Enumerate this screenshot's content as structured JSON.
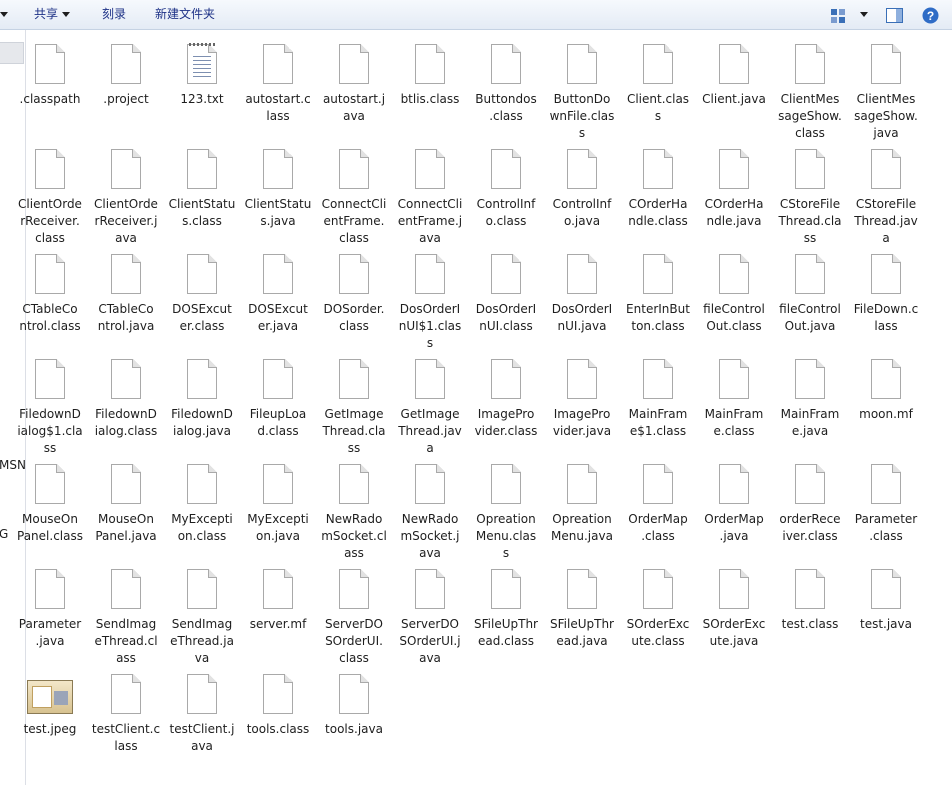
{
  "toolbar": {
    "share": "共享",
    "burn": "刻录",
    "new_folder": "新建文件夹"
  },
  "nav": {
    "msn": "MSN",
    "g": "G"
  },
  "files": [
    {
      "line1": ".classpath",
      "line2": "",
      "line3": "",
      "icon": "document-icon"
    },
    {
      "line1": ".project",
      "line2": "",
      "line3": "",
      "icon": "document-icon"
    },
    {
      "line1": "123.txt",
      "line2": "",
      "line3": "",
      "icon": "text-file-icon"
    },
    {
      "line1": "autostart.c",
      "line2": "lass",
      "line3": "",
      "icon": "document-icon"
    },
    {
      "line1": "autostart.j",
      "line2": "ava",
      "line3": "",
      "icon": "document-icon"
    },
    {
      "line1": "btlis.class",
      "line2": "",
      "line3": "",
      "icon": "document-icon"
    },
    {
      "line1": "Buttondos",
      "line2": ".class",
      "line3": "",
      "icon": "document-icon"
    },
    {
      "line1": "ButtonDo",
      "line2": "wnFile.clas",
      "line3": "s",
      "icon": "document-icon"
    },
    {
      "line1": "Client.clas",
      "line2": "s",
      "line3": "",
      "icon": "document-icon"
    },
    {
      "line1": "Client.java",
      "line2": "",
      "line3": "",
      "icon": "document-icon"
    },
    {
      "line1": "ClientMes",
      "line2": "sageShow.",
      "line3": "class",
      "icon": "document-icon"
    },
    {
      "line1": "ClientMes",
      "line2": "sageShow.",
      "line3": "java",
      "icon": "document-icon"
    },
    {
      "line1": "ClientOrde",
      "line2": "rReceiver.",
      "line3": "class",
      "icon": "document-icon"
    },
    {
      "line1": "ClientOrde",
      "line2": "rReceiver.j",
      "line3": "ava",
      "icon": "document-icon"
    },
    {
      "line1": "ClientStatu",
      "line2": "s.class",
      "line3": "",
      "icon": "document-icon"
    },
    {
      "line1": "ClientStatu",
      "line2": "s.java",
      "line3": "",
      "icon": "document-icon"
    },
    {
      "line1": "ConnectCli",
      "line2": "entFrame.",
      "line3": "class",
      "icon": "document-icon"
    },
    {
      "line1": "ConnectCli",
      "line2": "entFrame.j",
      "line3": "ava",
      "icon": "document-icon"
    },
    {
      "line1": "ControlInf",
      "line2": "o.class",
      "line3": "",
      "icon": "document-icon"
    },
    {
      "line1": "ControlInf",
      "line2": "o.java",
      "line3": "",
      "icon": "document-icon"
    },
    {
      "line1": "COrderHa",
      "line2": "ndle.class",
      "line3": "",
      "icon": "document-icon"
    },
    {
      "line1": "COrderHa",
      "line2": "ndle.java",
      "line3": "",
      "icon": "document-icon"
    },
    {
      "line1": "CStoreFile",
      "line2": "Thread.cla",
      "line3": "ss",
      "icon": "document-icon"
    },
    {
      "line1": "CStoreFile",
      "line2": "Thread.jav",
      "line3": "a",
      "icon": "document-icon"
    },
    {
      "line1": "CTableCo",
      "line2": "ntrol.class",
      "line3": "",
      "icon": "document-icon"
    },
    {
      "line1": "CTableCo",
      "line2": "ntrol.java",
      "line3": "",
      "icon": "document-icon"
    },
    {
      "line1": "DOSExcut",
      "line2": "er.class",
      "line3": "",
      "icon": "document-icon"
    },
    {
      "line1": "DOSExcut",
      "line2": "er.java",
      "line3": "",
      "icon": "document-icon"
    },
    {
      "line1": "DOSorder.",
      "line2": "class",
      "line3": "",
      "icon": "document-icon"
    },
    {
      "line1": "DosOrderI",
      "line2": "nUI$1.clas",
      "line3": "s",
      "icon": "document-icon"
    },
    {
      "line1": "DosOrderI",
      "line2": "nUI.class",
      "line3": "",
      "icon": "document-icon"
    },
    {
      "line1": "DosOrderI",
      "line2": "nUI.java",
      "line3": "",
      "icon": "document-icon"
    },
    {
      "line1": "EnterInBut",
      "line2": "ton.class",
      "line3": "",
      "icon": "document-icon"
    },
    {
      "line1": "fileControl",
      "line2": "Out.class",
      "line3": "",
      "icon": "document-icon"
    },
    {
      "line1": "fileControl",
      "line2": "Out.java",
      "line3": "",
      "icon": "document-icon"
    },
    {
      "line1": "FileDown.c",
      "line2": "lass",
      "line3": "",
      "icon": "document-icon"
    },
    {
      "line1": "FiledownD",
      "line2": "ialog$1.cla",
      "line3": "ss",
      "icon": "document-icon"
    },
    {
      "line1": "FiledownD",
      "line2": "ialog.class",
      "line3": "",
      "icon": "document-icon"
    },
    {
      "line1": "FiledownD",
      "line2": "ialog.java",
      "line3": "",
      "icon": "document-icon"
    },
    {
      "line1": "FileupLoa",
      "line2": "d.class",
      "line3": "",
      "icon": "document-icon"
    },
    {
      "line1": "GetImage",
      "line2": "Thread.cla",
      "line3": "ss",
      "icon": "document-icon"
    },
    {
      "line1": "GetImage",
      "line2": "Thread.jav",
      "line3": "a",
      "icon": "document-icon"
    },
    {
      "line1": "ImagePro",
      "line2": "vider.class",
      "line3": "",
      "icon": "document-icon"
    },
    {
      "line1": "ImagePro",
      "line2": "vider.java",
      "line3": "",
      "icon": "document-icon"
    },
    {
      "line1": "MainFram",
      "line2": "e$1.class",
      "line3": "",
      "icon": "document-icon"
    },
    {
      "line1": "MainFram",
      "line2": "e.class",
      "line3": "",
      "icon": "document-icon"
    },
    {
      "line1": "MainFram",
      "line2": "e.java",
      "line3": "",
      "icon": "document-icon"
    },
    {
      "line1": "moon.mf",
      "line2": "",
      "line3": "",
      "icon": "document-icon"
    },
    {
      "line1": "MouseOn",
      "line2": "Panel.class",
      "line3": "",
      "icon": "document-icon"
    },
    {
      "line1": "MouseOn",
      "line2": "Panel.java",
      "line3": "",
      "icon": "document-icon"
    },
    {
      "line1": "MyExcepti",
      "line2": "on.class",
      "line3": "",
      "icon": "document-icon"
    },
    {
      "line1": "MyExcepti",
      "line2": "on.java",
      "line3": "",
      "icon": "document-icon"
    },
    {
      "line1": "NewRado",
      "line2": "mSocket.cl",
      "line3": "ass",
      "icon": "document-icon"
    },
    {
      "line1": "NewRado",
      "line2": "mSocket.j",
      "line3": "ava",
      "icon": "document-icon"
    },
    {
      "line1": "Opreation",
      "line2": "Menu.clas",
      "line3": "s",
      "icon": "document-icon"
    },
    {
      "line1": "Opreation",
      "line2": "Menu.java",
      "line3": "",
      "icon": "document-icon"
    },
    {
      "line1": "OrderMap",
      "line2": ".class",
      "line3": "",
      "icon": "document-icon"
    },
    {
      "line1": "OrderMap",
      "line2": ".java",
      "line3": "",
      "icon": "document-icon"
    },
    {
      "line1": "orderRece",
      "line2": "iver.class",
      "line3": "",
      "icon": "document-icon"
    },
    {
      "line1": "Parameter",
      "line2": ".class",
      "line3": "",
      "icon": "document-icon"
    },
    {
      "line1": "Parameter",
      "line2": ".java",
      "line3": "",
      "icon": "document-icon"
    },
    {
      "line1": "SendImag",
      "line2": "eThread.cl",
      "line3": "ass",
      "icon": "document-icon"
    },
    {
      "line1": "SendImag",
      "line2": "eThread.ja",
      "line3": "va",
      "icon": "document-icon"
    },
    {
      "line1": "server.mf",
      "line2": "",
      "line3": "",
      "icon": "document-icon"
    },
    {
      "line1": "ServerDO",
      "line2": "SOrderUI.",
      "line3": "class",
      "icon": "document-icon"
    },
    {
      "line1": "ServerDO",
      "line2": "SOrderUI.j",
      "line3": "ava",
      "icon": "document-icon"
    },
    {
      "line1": "SFileUpThr",
      "line2": "ead.class",
      "line3": "",
      "icon": "document-icon"
    },
    {
      "line1": "SFileUpThr",
      "line2": "ead.java",
      "line3": "",
      "icon": "document-icon"
    },
    {
      "line1": "SOrderExc",
      "line2": "ute.class",
      "line3": "",
      "icon": "document-icon"
    },
    {
      "line1": "SOrderExc",
      "line2": "ute.java",
      "line3": "",
      "icon": "document-icon"
    },
    {
      "line1": "test.class",
      "line2": "",
      "line3": "",
      "icon": "document-icon"
    },
    {
      "line1": "test.java",
      "line2": "",
      "line3": "",
      "icon": "document-icon"
    },
    {
      "line1": "test.jpeg",
      "line2": "",
      "line3": "",
      "icon": "image-thumbnail-icon"
    },
    {
      "line1": "testClient.c",
      "line2": "lass",
      "line3": "",
      "icon": "document-icon"
    },
    {
      "line1": "testClient.j",
      "line2": "ava",
      "line3": "",
      "icon": "document-icon"
    },
    {
      "line1": "tools.class",
      "line2": "",
      "line3": "",
      "icon": "document-icon"
    },
    {
      "line1": "tools.java",
      "line2": "",
      "line3": "",
      "icon": "document-icon"
    }
  ]
}
